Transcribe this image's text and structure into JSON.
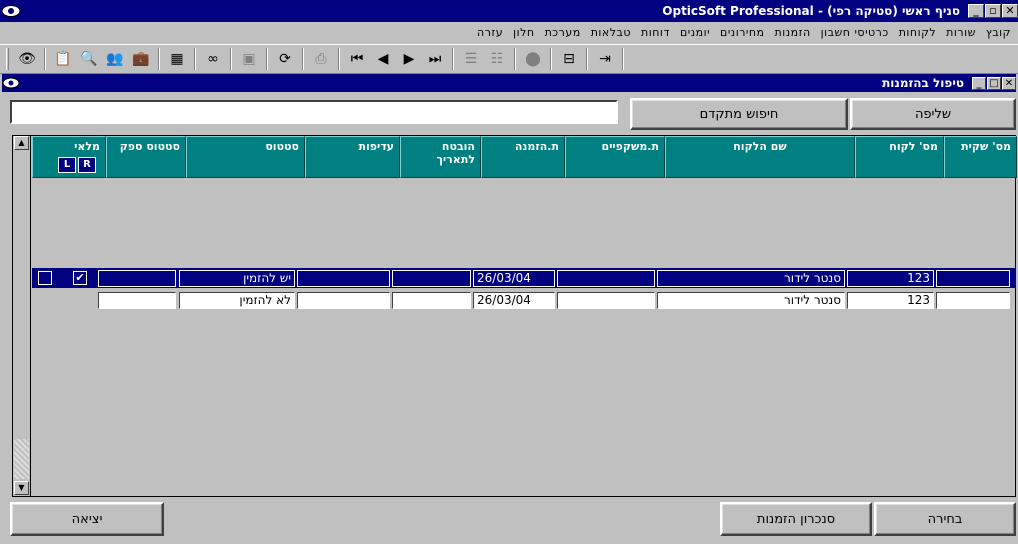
{
  "window": {
    "title": "OpticSoft Professional - סניף ראשי (סטיקה רפי)",
    "controls": {
      "close": "✕",
      "restore": "🗗",
      "minimize": "_"
    }
  },
  "menu": [
    "קובץ",
    "שורות",
    "לקוחות",
    "כרטיסי חשבון",
    "הזמנות",
    "מחירונים",
    "יומנים",
    "דוחות",
    "טבלאות",
    "מערכת",
    "חלון",
    "עזרה"
  ],
  "child_window": {
    "title": "טיפול בהזמנות"
  },
  "search": {
    "value": "",
    "advanced_button": "חיפוש מתקדם",
    "retrieve_button": "שליפה"
  },
  "table": {
    "columns": [
      "מס' שקית",
      "מס' לקוח",
      "שם הלקוח",
      "ת.משקפיים",
      "ת.הזמנה",
      "הובטח לתאריך",
      "עדיפות",
      "סטטוס",
      "סטטוס ספק",
      "מלאי"
    ],
    "stock_sub": {
      "right": "R",
      "left": "L"
    },
    "rows": [
      {
        "bag": "",
        "customer_no": "123",
        "customer_name": "סנטר לידור",
        "glasses_date": "",
        "order_date": "26/03/04",
        "promised": "",
        "priority": "",
        "status": "יש להזמין",
        "supplier_status": "",
        "stock_r": "✔",
        "stock_l": "",
        "selected": true
      },
      {
        "bag": "",
        "customer_no": "123",
        "customer_name": "סנטר לידור",
        "glasses_date": "",
        "order_date": "26/03/04",
        "promised": "",
        "priority": "",
        "status": "לא להזמין",
        "supplier_status": "",
        "stock_r": null,
        "stock_l": null,
        "selected": false
      }
    ]
  },
  "footer": {
    "select_button": "בחירה",
    "sync_button": "סנכרון הזמנות",
    "exit_button": "יציאה"
  }
}
